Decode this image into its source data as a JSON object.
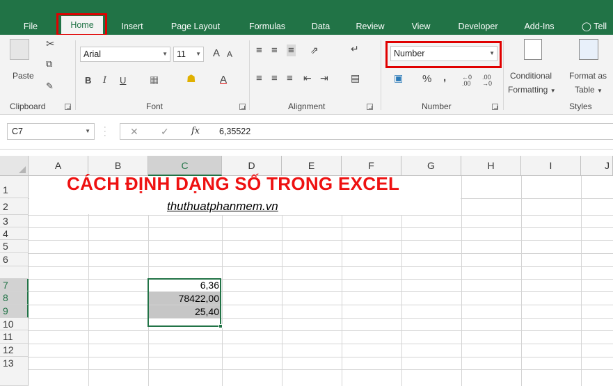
{
  "tabs": [
    "File",
    "Home",
    "Insert",
    "Page Layout",
    "Formulas",
    "Data",
    "Review",
    "View",
    "Developer",
    "Add-Ins",
    "Tell"
  ],
  "active_tab": "Home",
  "ribbon": {
    "clipboard": {
      "paste": "Paste",
      "label": "Clipboard"
    },
    "font": {
      "name": "Arial",
      "size": "11",
      "bold": "B",
      "italic": "I",
      "underline": "U",
      "grow": "A",
      "shrink": "A",
      "color_letter": "A",
      "label": "Font"
    },
    "alignment": {
      "label": "Alignment"
    },
    "number": {
      "format": "Number",
      "percent": "%",
      "comma": ",",
      "inc_decimals": "←0 .00",
      "dec_decimals": ".00 →0",
      "label": "Number"
    },
    "styles": {
      "conditional_1": "Conditional",
      "conditional_2": "Formatting",
      "format_as_1": "Format as",
      "format_as_2": "Table",
      "label": "Styles"
    }
  },
  "formula_bar": {
    "name_box": "C7",
    "fx": "fx",
    "value": "6,35522"
  },
  "columns": [
    "A",
    "B",
    "C",
    "D",
    "E",
    "F",
    "G",
    "H",
    "I",
    "J"
  ],
  "selected_column": "C",
  "rows": [
    "1",
    "2",
    "3",
    "4",
    "5",
    "6",
    "7",
    "8",
    "9",
    "10",
    "11",
    "12",
    "13"
  ],
  "selected_rows": [
    "7",
    "8",
    "9"
  ],
  "sheet": {
    "title": "CÁCH ĐỊNH DẠNG SỐ TRONG EXCEL",
    "subtitle": "thuthuatphanmem.vn",
    "c7": "6,36",
    "c8": "78422,00",
    "c9": "25,40"
  },
  "colors": {
    "brand": "#217346",
    "highlight": "#e00000",
    "title": "#ee1111"
  }
}
